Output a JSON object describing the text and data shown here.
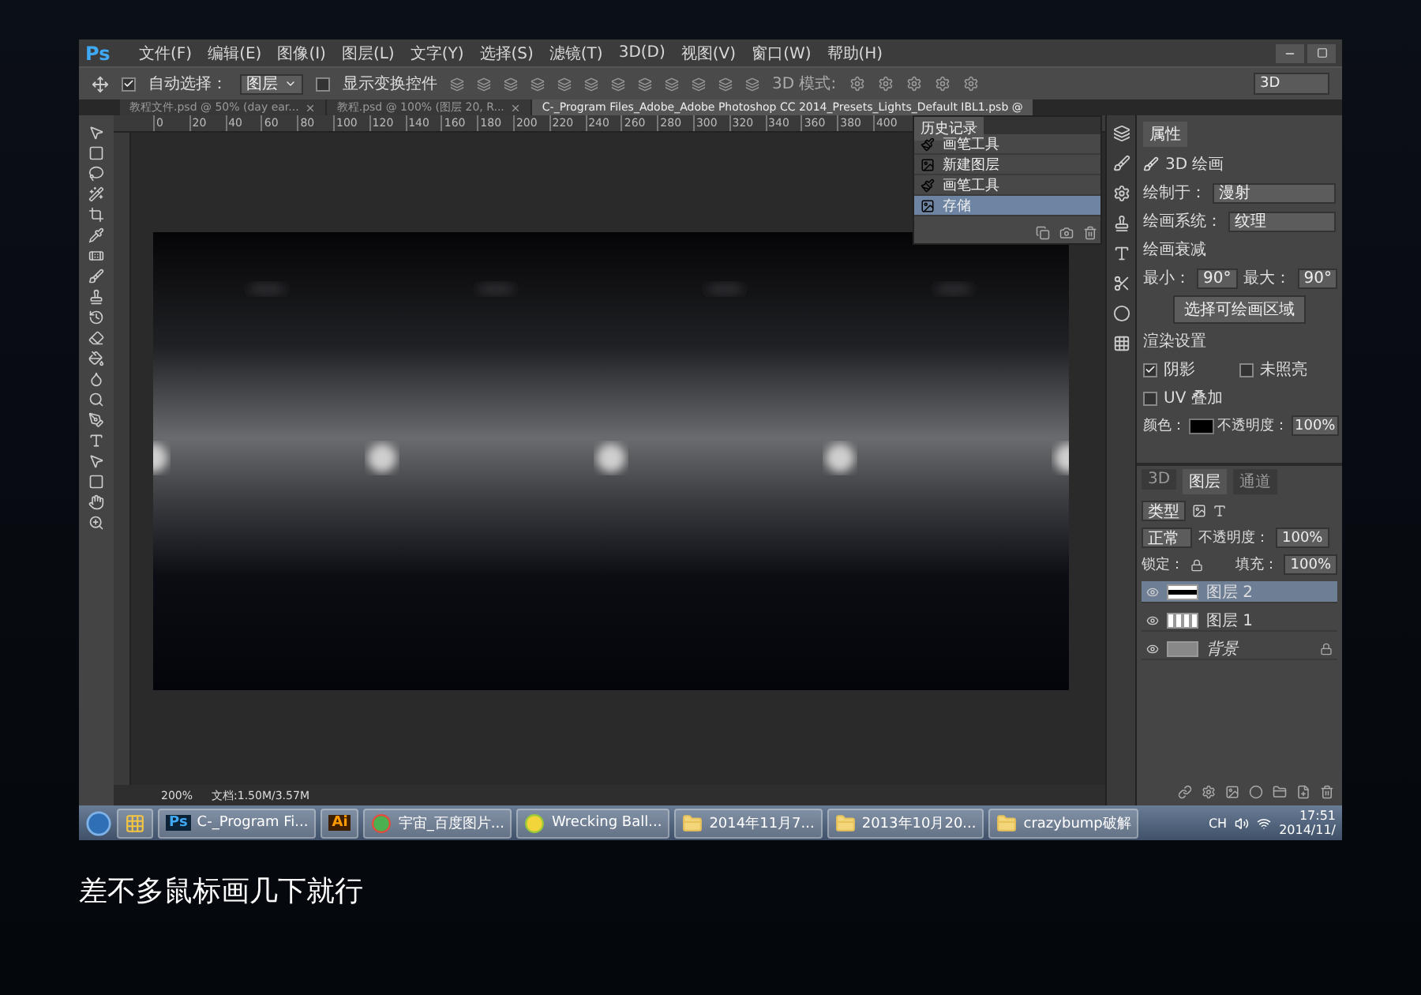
{
  "menu_bar": {
    "logo": "Ps",
    "items": [
      "文件(F)",
      "编辑(E)",
      "图像(I)",
      "图层(L)",
      "文字(Y)",
      "选择(S)",
      "滤镜(T)",
      "3D(D)",
      "视图(V)",
      "窗口(W)",
      "帮助(H)"
    ]
  },
  "options_bar": {
    "auto_select": {
      "label": "自动选择：",
      "checked": true
    },
    "auto_select_target": "图层",
    "show_transform": {
      "label": "显示变换控件",
      "checked": false
    },
    "mode_label": "3D 模式:",
    "workspace": "3D"
  },
  "document_tabs": [
    {
      "title": "教程文件.psd @ 50% (day ear...",
      "selected": false
    },
    {
      "title": "教程.psd @ 100% (图层 20, R...",
      "selected": false
    },
    {
      "title": "C-_Program Files_Adobe_Adobe Photoshop CC 2014_Presets_Lights_Default IBL1.psb @",
      "selected": true
    }
  ],
  "ruler_marks": [
    "0",
    "20",
    "40",
    "60",
    "80",
    "100",
    "120",
    "140",
    "160",
    "180",
    "200",
    "220",
    "240",
    "260",
    "280",
    "300",
    "320",
    "340",
    "360",
    "380",
    "400"
  ],
  "history_panel": {
    "title": "历史记录",
    "items": [
      {
        "label": "画笔工具",
        "kind": "brush",
        "selected": false
      },
      {
        "label": "新建图层",
        "kind": "layer",
        "selected": false
      },
      {
        "label": "画笔工具",
        "kind": "brush",
        "selected": false
      },
      {
        "label": "存储",
        "kind": "layer",
        "selected": true
      }
    ]
  },
  "properties_panel": {
    "tab": "属性",
    "heading": "3D 绘画",
    "paint_on_label": "绘制于：",
    "paint_on": "漫射",
    "paint_system_label": "绘画系统：",
    "paint_system": "纹理",
    "falloff_title": "绘画衰减",
    "min_label": "最小：",
    "min": "90°",
    "max_label": "最大：",
    "max": "90°",
    "select_button": "选择可绘画区域",
    "render_title": "渲染设置",
    "shadow": {
      "label": "阴影",
      "checked": true
    },
    "unlit": {
      "label": "未照亮",
      "checked": false
    },
    "uv_overlay": {
      "label": "UV 叠加",
      "checked": false
    },
    "color_label": "颜色：",
    "color": "#000000",
    "opacity_label": "不透明度：",
    "opacity": "100%"
  },
  "layers_panel": {
    "tabs": [
      {
        "label": "3D",
        "selected": false
      },
      {
        "label": "图层",
        "selected": true
      },
      {
        "label": "通道",
        "selected": false
      }
    ],
    "filter": "类型",
    "blend_mode": "正常",
    "opacity_label": "不透明度：",
    "opacity": "100%",
    "lock_label": "锁定：",
    "fill_label": "填充：",
    "fill": "100%",
    "layers": [
      {
        "name": "图层 2",
        "kind": "dark",
        "selected": true,
        "locked": false
      },
      {
        "name": "图层 1",
        "kind": "dots",
        "selected": false,
        "locked": false
      },
      {
        "name": "背景",
        "kind": "background",
        "selected": false,
        "locked": true
      }
    ]
  },
  "status_bar": {
    "zoom": "200%",
    "document": "文档:1.50M/3.57M"
  },
  "taskbar": {
    "items": [
      {
        "kind": "apps"
      },
      {
        "kind": "ps",
        "badge": "Ps",
        "label": "C-_Program Fi..."
      },
      {
        "kind": "ai",
        "badge": "Ai"
      },
      {
        "kind": "chrome",
        "label": "宇宙_百度图片..."
      },
      {
        "kind": "music",
        "label": "Wrecking Ball..."
      },
      {
        "kind": "folder",
        "label": "2014年11月7..."
      },
      {
        "kind": "folder",
        "label": "2013年10月20..."
      },
      {
        "kind": "folder",
        "label": "crazybump破解"
      }
    ],
    "language": "CH",
    "time": "17:51",
    "date": "2014/11/"
  },
  "caption": "差不多鼠标画几下就行"
}
